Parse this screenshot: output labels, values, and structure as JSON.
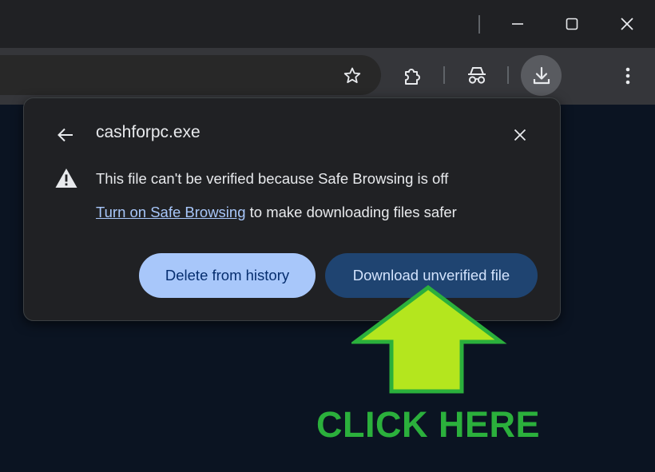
{
  "browser": {
    "icons": {
      "minimize": "minimize-icon",
      "maximize": "maximize-icon",
      "close": "close-icon",
      "bookmark": "star-icon",
      "extensions": "puzzle-piece-icon",
      "incognito": "incognito-icon",
      "downloads": "download-icon",
      "menu": "three-dot-menu-icon"
    }
  },
  "dialog": {
    "filename": "cashforpc.exe",
    "warning": "This file can't be verified because Safe Browsing is off",
    "link_text": "Turn on Safe Browsing",
    "link_suffix": " to make downloading files safer",
    "delete_button": "Delete from history",
    "download_button": "Download unverified file",
    "icons": {
      "back": "back-arrow-icon",
      "close": "close-icon",
      "warning": "warning-triangle-icon"
    }
  },
  "overlay": {
    "cta_text": "CLICK HERE",
    "arrow_color": "#b4e61e",
    "arrow_outline": "#2bb03c",
    "text_color": "#2bb03c"
  },
  "colors": {
    "page_bg": "#0b1422",
    "dialog_bg": "#202124",
    "primary_button": "#a8c7fa",
    "secondary_button": "#1f4471",
    "link": "#a8c7fa"
  }
}
